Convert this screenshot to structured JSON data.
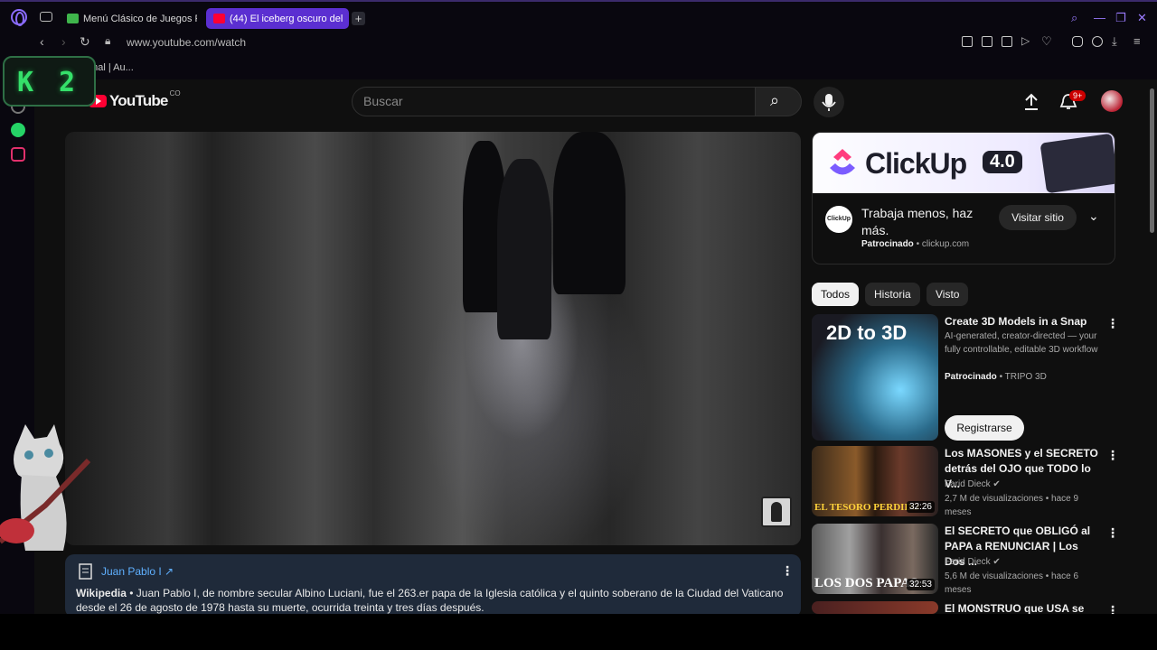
{
  "browser": {
    "tabs": [
      {
        "title": "Menú Clásico de Juegos F"
      },
      {
        "title": "(44) El iceberg oscuro del"
      }
    ],
    "new_tab_label": "+",
    "url": "www.youtube.com/watch",
    "bookmark_text": "onal | Au...",
    "k2_overlay": {
      "k": "K",
      "n": "2"
    },
    "accent_color": "#8b6cff"
  },
  "youtube": {
    "logo_word": "YouTube",
    "country_code": "CO",
    "search_placeholder": "Buscar",
    "notification_badge": "9+",
    "video_info": {
      "title": "Juan Pablo I ↗",
      "source": "Wikipedia",
      "text": " • Juan Pablo I, de nombre secular Albino Luciani, fue el 263.er papa de la Iglesia católica y el quinto soberano de la Ciudad del Vaticano desde el 26 de agosto de 1978 hasta su muerte, ocurrida treinta y tres días después."
    },
    "ad": {
      "brand_word": "ClickUp",
      "version": "4.0",
      "logo_text": "ClickUp",
      "headline": "Trabaja menos, haz más.",
      "sponsored": "Patrocinado",
      "domain": " • clickup.com",
      "visit_label": "Visitar sitio"
    },
    "chips": [
      "Todos",
      "Historia",
      "Visto"
    ],
    "recommendations": [
      {
        "thumb_text": "2D to 3D",
        "title": "Create 3D Models in a Snap",
        "meta1": "AI-generated, creator-directed — your fully controllable, editable 3D workflow",
        "sponsored": "Patrocinado",
        "channel": " • TRIPO 3D",
        "button": "Registrarse"
      },
      {
        "thumb_text": "EL TESORO PERDIDO",
        "duration": "32:26",
        "title": "Los MASONES y el SECRETO detrás del OJO que TODO lo V...",
        "channel": "Farid Dieck ✔",
        "stats": "2,7 M de visualizaciones • hace 9 meses"
      },
      {
        "thumb_text": "LOS DOS PAPAS",
        "duration": "32:53",
        "title": "El SECRETO que OBLIGÓ al PAPA a RENUNCIAR | Los Dos ...",
        "channel": "Farid Dieck ✔",
        "stats": "5,6 M de visualizaciones • hace 6 meses"
      },
      {
        "title": "El MONSTRUO que USA se"
      }
    ]
  }
}
